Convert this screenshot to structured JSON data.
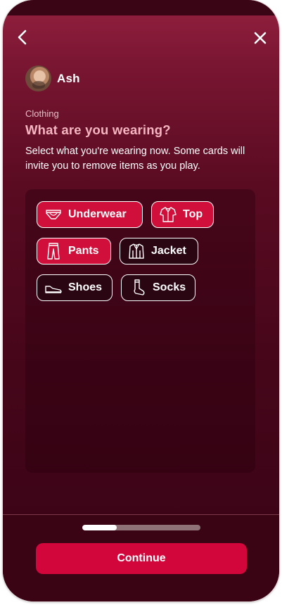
{
  "header": {
    "back_icon": "chevron-left-icon",
    "close_icon": "close-icon"
  },
  "profile": {
    "name": "Ash"
  },
  "content": {
    "section_label": "Clothing",
    "title": "What are you wearing?",
    "subtitle": "Select what you're wearing now. Some cards will invite you to remove items as you play."
  },
  "clothing_options": [
    {
      "label": "Underwear",
      "icon": "underwear-icon",
      "selected": true
    },
    {
      "label": "Top",
      "icon": "shirt-icon",
      "selected": true
    },
    {
      "label": "Pants",
      "icon": "pants-icon",
      "selected": true
    },
    {
      "label": "Jacket",
      "icon": "jacket-icon",
      "selected": false
    },
    {
      "label": "Shoes",
      "icon": "shoe-icon",
      "selected": false
    },
    {
      "label": "Socks",
      "icon": "sock-icon",
      "selected": false
    }
  ],
  "footer": {
    "progress_fraction": 0.29,
    "continue_label": "Continue"
  },
  "colors": {
    "accent": "#d2063a",
    "background_top": "#93203f",
    "background_bottom": "#3b0414",
    "title": "#f4b6c0"
  }
}
